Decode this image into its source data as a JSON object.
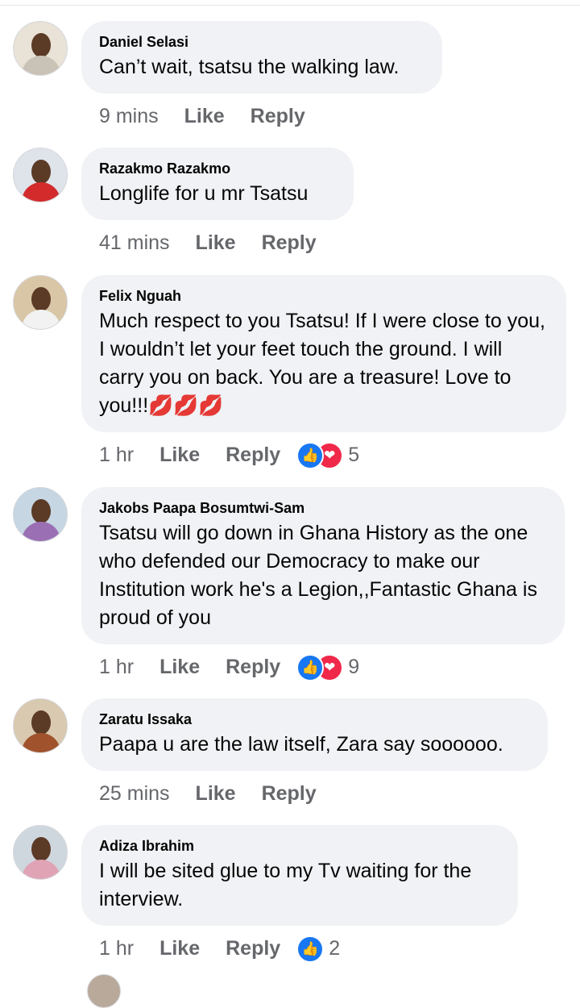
{
  "comments": [
    {
      "name": "Daniel Selasi",
      "text": "Can’t wait, tsatsu the walking law.",
      "time": "9 mins",
      "like": "Like",
      "reply": "Reply",
      "reactions": ""
    },
    {
      "name": "Razakmo Razakmo",
      "text": "Longlife for u mr Tsatsu",
      "time": "41 mins",
      "like": "Like",
      "reply": "Reply",
      "reactions": ""
    },
    {
      "name": "Felix Nguah",
      "text": "Much respect to you Tsatsu! If I were close to you, I wouldn’t let your feet touch the ground. I will carry you on back. You are a treasure! Love to you!!!💋💋💋",
      "time": "1 hr",
      "like": "Like",
      "reply": "Reply",
      "reactions": "5"
    },
    {
      "name": "Jakobs Paapa Bosumtwi-Sam",
      "text": "Tsatsu will go down in Ghana History as the one who defended our Democracy to make our Institution work he's a Legion,,Fantastic Ghana is proud of you",
      "time": "1 hr",
      "like": "Like",
      "reply": "Reply",
      "reactions": "9"
    },
    {
      "name": "Zaratu Issaka",
      "text": "Paapa u are the law itself, Zara say soooooo.",
      "time": "25 mins",
      "like": "Like",
      "reply": "Reply",
      "reactions": ""
    },
    {
      "name": "Adiza Ibrahim",
      "text": "I will be sited glue to my Tv waiting for the interview.",
      "time": "1 hr",
      "like": "Like",
      "reply": "Reply",
      "reactions": "2"
    }
  ],
  "icons": {
    "like": "thumbs-up-icon",
    "love": "heart-icon"
  },
  "colors": {
    "bubble": "#f0f2f5",
    "meta": "#65676b",
    "like_blue": "#1877f2",
    "love_red": "#f02849"
  }
}
